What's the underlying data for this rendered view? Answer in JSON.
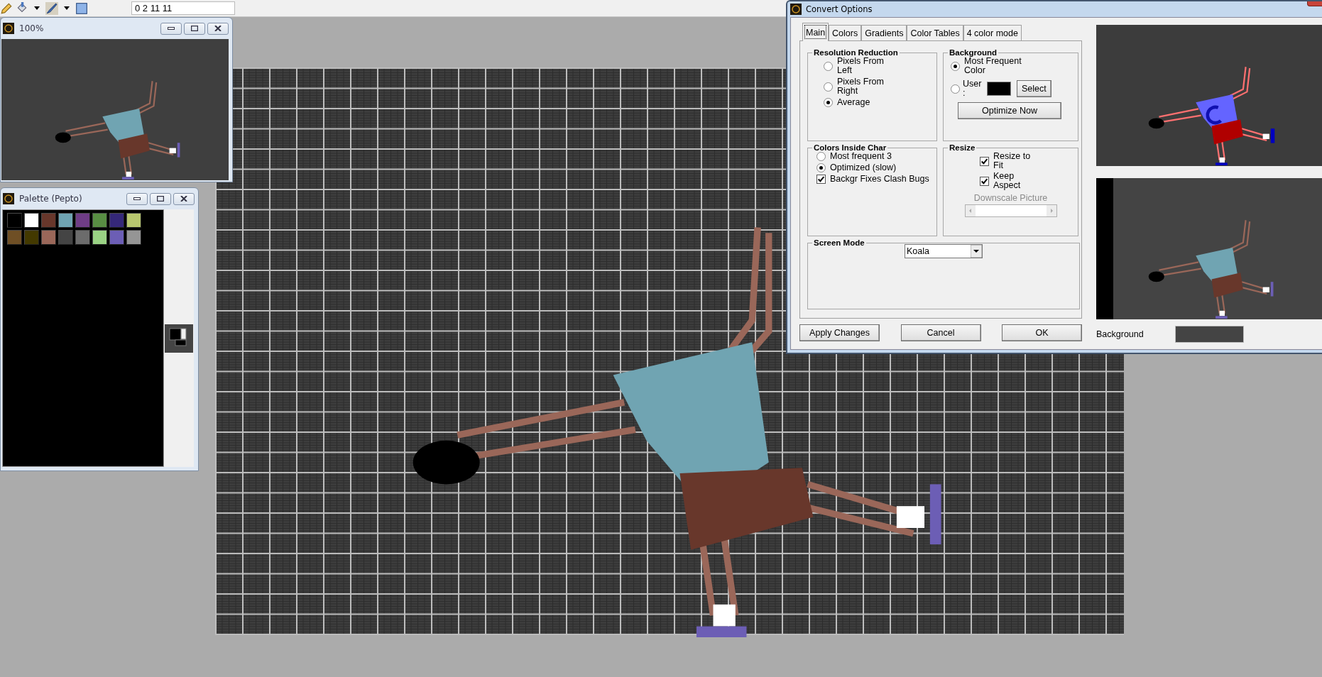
{
  "toolbar": {
    "coordinates": "0 2 11 11"
  },
  "preview_window": {
    "title": "100%"
  },
  "palette_window": {
    "title": "Palette (Pepto)",
    "colors": [
      {
        "color": "#000000"
      },
      {
        "color": "#ffffff"
      },
      {
        "color": "#68372b"
      },
      {
        "color": "#70a4b2"
      },
      {
        "color": "#6f3d86"
      },
      {
        "color": "#588d43"
      },
      {
        "color": "#352879"
      },
      {
        "color": "#b8c76f"
      },
      {
        "color": "#6f4f25"
      },
      {
        "color": "#433900"
      },
      {
        "color": "#9a6759"
      },
      {
        "color": "#444444"
      },
      {
        "color": "#6c6c6c"
      },
      {
        "color": "#9ad284"
      },
      {
        "color": "#6c5eb5"
      },
      {
        "color": "#959595"
      }
    ]
  },
  "convert_options": {
    "title": "Convert Options",
    "tabs": [
      {
        "label": "Main",
        "selected": true
      },
      {
        "label": "Colors",
        "selected": false
      },
      {
        "label": "Gradients",
        "selected": false
      },
      {
        "label": "Color Tables",
        "selected": false
      },
      {
        "label": "4 color mode",
        "selected": false
      }
    ],
    "resolution_reduction": {
      "title": "Resolution Reduction",
      "options": [
        {
          "label": "Pixels From Left",
          "selected": false
        },
        {
          "label": "Pixels From Right",
          "selected": false
        },
        {
          "label": "Average",
          "selected": true
        }
      ]
    },
    "background": {
      "title": "Background",
      "options": [
        {
          "label": "Most Frequent Color",
          "selected": true
        },
        {
          "label": "User :",
          "selected": false
        }
      ],
      "select_button": "Select",
      "optimize_button": "Optimize Now"
    },
    "colors_inside_char": {
      "title": "Colors Inside Char",
      "options": [
        {
          "label": "Most frequent 3",
          "selected": false
        },
        {
          "label": "Optimized (slow)",
          "selected": true
        }
      ],
      "clash_fix": {
        "label": "Backgr Fixes Clash Bugs",
        "checked": true
      }
    },
    "resize": {
      "title": "Resize",
      "options": [
        {
          "label": "Resize to Fit",
          "checked": true
        },
        {
          "label": "Keep Aspect",
          "checked": true
        }
      ],
      "downscale": {
        "label": "Downscale Picture",
        "disabled": true
      }
    },
    "screen_mode": {
      "title": "Screen Mode",
      "value": "Koala"
    },
    "buttons": [
      "Apply Changes",
      "Cancel",
      "OK"
    ],
    "background_label": "Background"
  }
}
